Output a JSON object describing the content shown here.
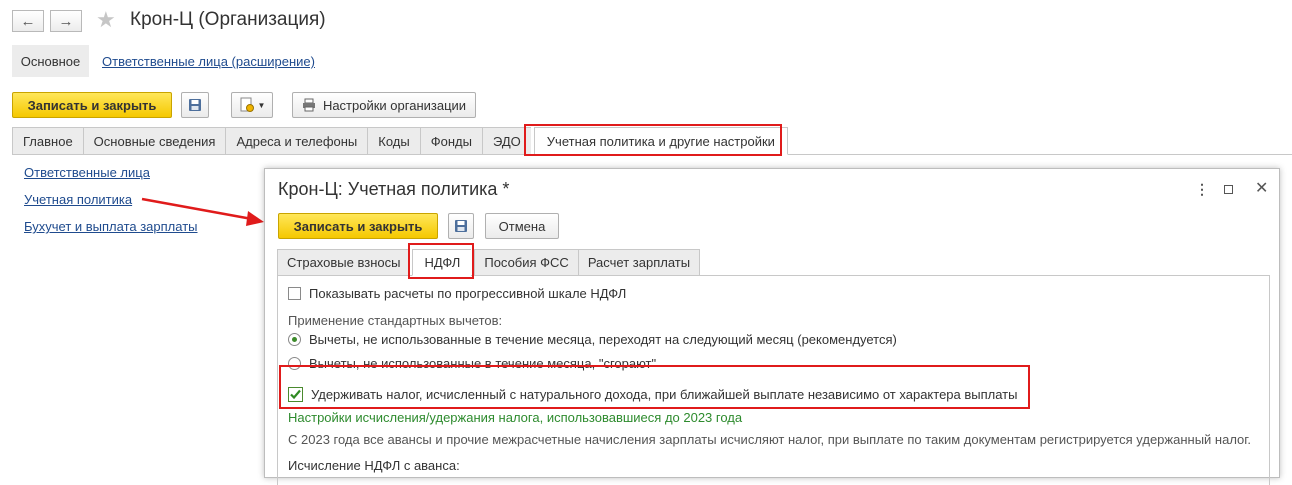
{
  "nav": {
    "back_icon": "←",
    "forward_icon": "→"
  },
  "window": {
    "title": "Крон-Ц (Организация)"
  },
  "sections": {
    "basic": "Основное",
    "responsible_ext": "Ответственные лица (расширение)"
  },
  "toolbar": {
    "save_close": "Записать и закрыть",
    "org_settings": "Настройки организации"
  },
  "tabs": [
    "Главное",
    "Основные сведения",
    "Адреса и телефоны",
    "Коды",
    "Фонды",
    "ЭДО",
    "Учетная политика и другие настройки"
  ],
  "left_links": [
    "Ответственные лица",
    "Учетная политика",
    "Бухучет и выплата зарплаты"
  ],
  "dialog": {
    "title": "Крон-Ц: Учетная политика *",
    "save_close": "Записать и закрыть",
    "cancel": "Отмена",
    "tabs": [
      "Страховые взносы",
      "НДФЛ",
      "Пособия ФСС",
      "Расчет зарплаты"
    ],
    "progressive_scale": "Показывать расчеты по прогрессивной шкале НДФЛ",
    "std_deductions_label": "Применение стандартных вычетов:",
    "radio_carry": "Вычеты, не использованные в течение месяца, переходят на следующий месяц (рекомендуется)",
    "radio_burn": "Вычеты, не использованные в течение месяца, \"сгорают\"",
    "withhold_natural": "Удерживать налог, исчисленный с натурального дохода, при ближайшей выплате независимо от характера выплаты",
    "pre2023_link": "Настройки исчисления/удержания налога, использовавшиеся до 2023 года",
    "note_2023": "С 2023 года все авансы и прочие межрасчетные начисления зарплаты исчисляют налог, при выплате по таким документам регистрируется удержанный налог.",
    "advance_calc": "Исчисление НДФЛ с аванса:"
  },
  "colors": {
    "accent_yellow": "#f5c800",
    "highlight_red": "#e01b1b",
    "link_blue": "#1f4b8e",
    "green_text": "#2e8b2e"
  }
}
